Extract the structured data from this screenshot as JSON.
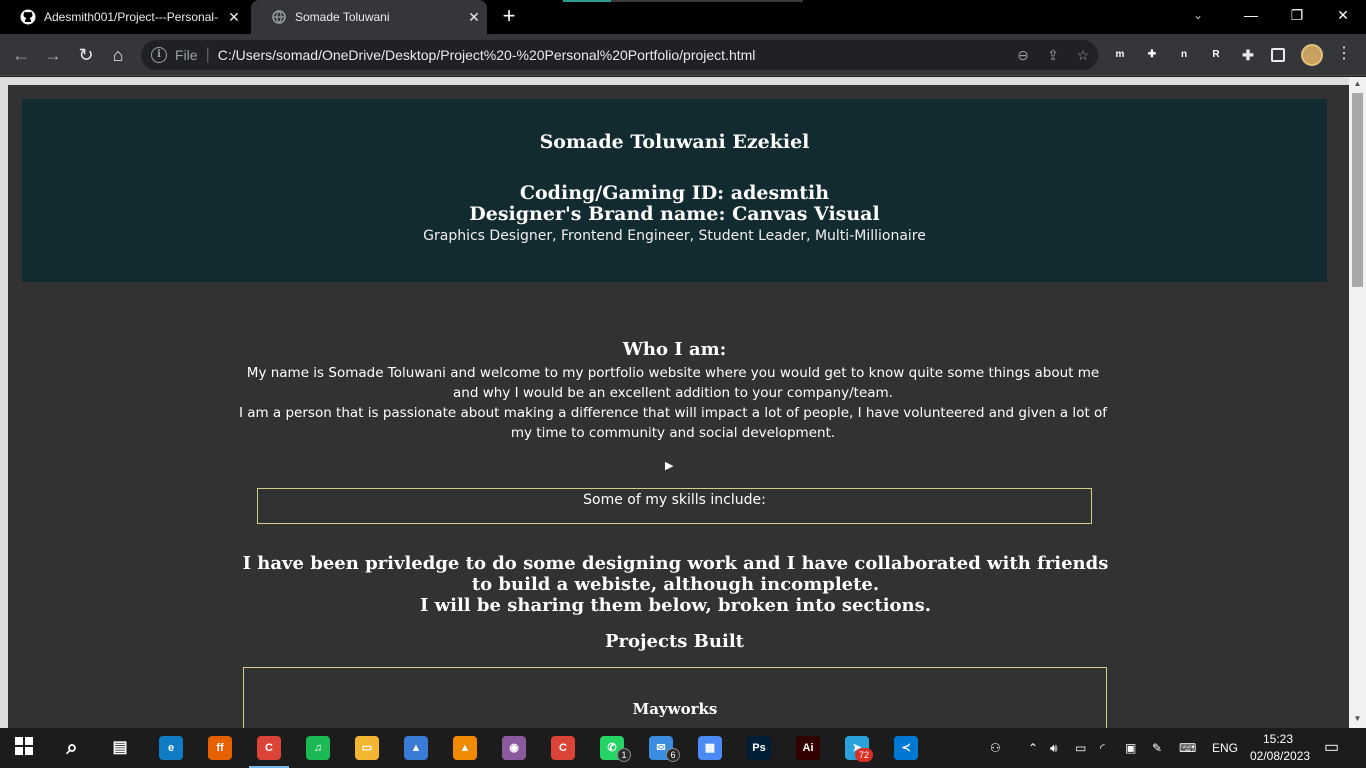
{
  "browser": {
    "tabs": [
      {
        "title": "Adesmith001/Project---Personal-",
        "active": false,
        "favicon": "github-icon"
      },
      {
        "title": "Somade Toluwani",
        "active": true,
        "favicon": "globe-icon"
      }
    ],
    "new_tab": "+",
    "address": {
      "scheme": "File",
      "url": "C:/Users/somad/OneDrive/Desktop/Project%20-%20Personal%20Portfolio/project.html"
    },
    "extensions": [
      {
        "name": "extension-m-icon",
        "letter": "m",
        "color": "#00b3b3"
      },
      {
        "name": "extension-puzzle-blue-icon",
        "letter": "✚",
        "color": "#5a6ea8"
      },
      {
        "name": "extension-n-icon",
        "letter": "n",
        "color": "#1e88e5"
      },
      {
        "name": "extension-grey-icon",
        "letter": "R",
        "color": "#808080"
      }
    ]
  },
  "page": {
    "name": "Somade Toluwani Ezekiel",
    "gaming_id": "Coding/Gaming ID: adesmtih",
    "brand": "Designer's Brand name: Canvas Visual",
    "roles": "Graphics Designer, Frontend Engineer, Student Leader, Multi-Millionaire",
    "who_heading": "Who I am:",
    "who_para1": "My name is Somade Toluwani and welcome to my portfolio website where you would get to know quite some things about me and why I would be an excellent addition to your company/team.",
    "who_para2": "I am a person that is passionate about making a difference that will impact a lot of people, I have volunteered and given a lot of my time to community and social development.",
    "disclosure": "▶",
    "skills_label": "Some of my skills include:",
    "privledge_line1": "I have been privledge to do some designing work and I have collaborated with friends to build a webiste, although incomplete.",
    "privledge_line2": "I will be sharing them below, broken into sections.",
    "projects_heading": "Projects Built",
    "project_title": "Mayworks"
  },
  "taskbar": {
    "lang": "ENG",
    "time": "15:23",
    "date": "02/08/2023",
    "badges": {
      "whatsapp": "1",
      "mail": "6",
      "telegram": "72"
    },
    "apps": [
      {
        "name": "edge-icon",
        "label": "e",
        "color": "#0f7cc4"
      },
      {
        "name": "firefox-icon",
        "label": "ff",
        "color": "#e66000"
      },
      {
        "name": "chrome-icon",
        "label": "C",
        "color": "#db4437"
      },
      {
        "name": "spotify-icon",
        "label": "♫",
        "color": "#1db954"
      },
      {
        "name": "file-explorer-icon",
        "label": "▭",
        "color": "#f2b632"
      },
      {
        "name": "photos-icon",
        "label": "▲",
        "color": "#3a7bd5"
      },
      {
        "name": "vlc-icon",
        "label": "▲",
        "color": "#f08a00"
      },
      {
        "name": "media-icon",
        "label": "◉",
        "color": "#8a5a9c"
      },
      {
        "name": "chrome-profile-icon",
        "label": "C",
        "color": "#db4437"
      },
      {
        "name": "whatsapp-icon",
        "label": "✆",
        "color": "#25d366"
      },
      {
        "name": "mail-icon",
        "label": "✉",
        "color": "#3a8de0"
      },
      {
        "name": "store-icon",
        "label": "▦",
        "color": "#4c8bf5"
      },
      {
        "name": "photoshop-icon",
        "label": "Ps",
        "color": "#001e36"
      },
      {
        "name": "illustrator-icon",
        "label": "Ai",
        "color": "#330000"
      },
      {
        "name": "telegram-icon",
        "label": "➤",
        "color": "#2aa1da"
      },
      {
        "name": "vscode-icon",
        "label": "≺",
        "color": "#0078d4"
      }
    ]
  }
}
